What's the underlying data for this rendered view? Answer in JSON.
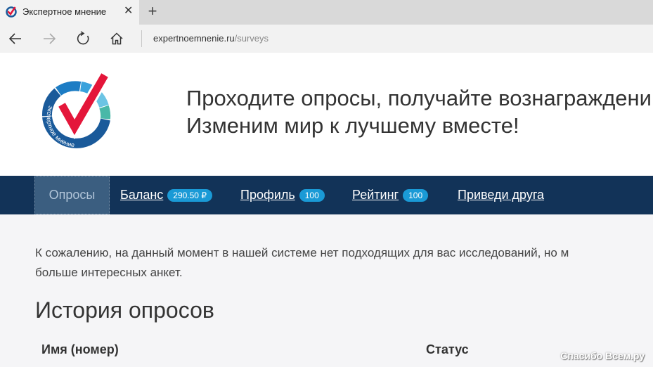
{
  "browser": {
    "tab_title": "Экспертное мнение",
    "close_glyph": "✕",
    "newtab_glyph": "+",
    "url_host": "expertnoemnenie.ru",
    "url_path": "/surveys",
    "icons": [
      "back-arrow-icon",
      "forward-arrow-icon",
      "refresh-icon",
      "home-icon"
    ]
  },
  "header": {
    "slogan_line1": "Проходите опросы, получайте вознаграждени",
    "slogan_line2": "Изменим мир к лучшему вместе!",
    "logo_text": "экспертное мнение"
  },
  "nav": {
    "surveys": "Опросы",
    "balance": "Баланс",
    "balance_badge": "290.50 ₽",
    "profile": "Профиль",
    "profile_badge": "100",
    "rating": "Рейтинг",
    "rating_badge": "100",
    "invite": "Приведи друга"
  },
  "content": {
    "notice_line1": "К сожалению, на данный момент в нашей системе нет подходящих для вас исследований, но м",
    "notice_line2": "больше интересных анкет.",
    "history_title": "История опросов",
    "col_name": "Имя (номер)",
    "col_status": "Статус"
  },
  "watermark": "Спасибо Всем.ру",
  "colors": {
    "nav_bg": "#123358",
    "nav_active_bg": "#3b5e80",
    "badge_bg": "#1a9ad6",
    "logo_red": "#e4163a",
    "logo_blue": "#1a5a9a"
  }
}
